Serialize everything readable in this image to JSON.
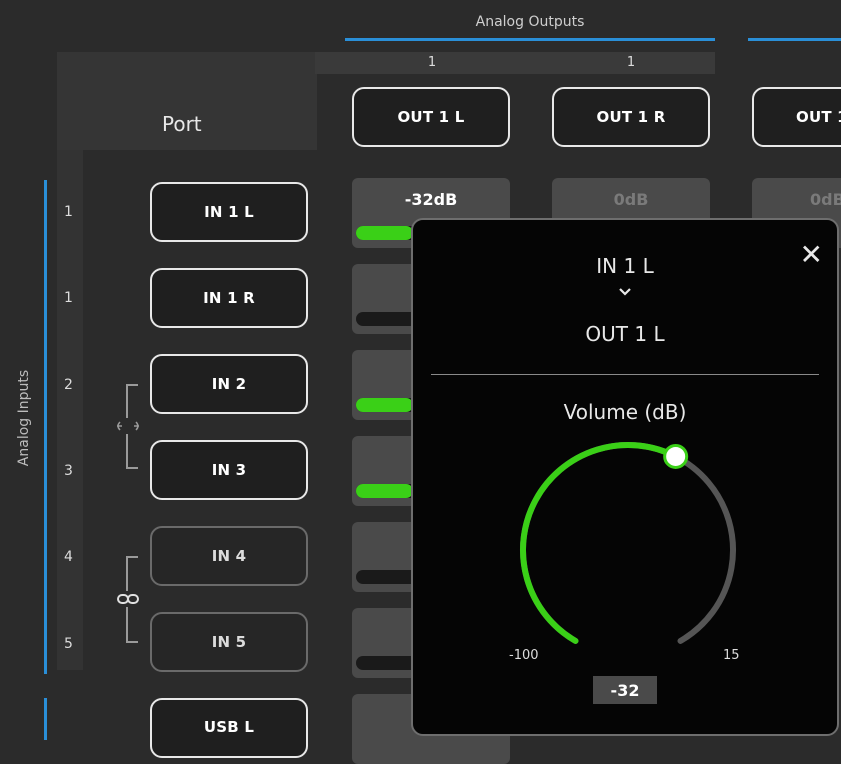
{
  "header": {
    "outputs_group_title": "Analog Outputs",
    "output_numbers": [
      "1",
      "1"
    ],
    "port_label": "Port"
  },
  "outputs": [
    {
      "label": "OUT 1 L"
    },
    {
      "label": "OUT 1 R"
    },
    {
      "label": "OUT 1"
    }
  ],
  "inputs_group_title": "Analog Inputs",
  "inputs": [
    {
      "num": "1",
      "label": "IN 1 L",
      "dim": false
    },
    {
      "num": "1",
      "label": "IN 1 R",
      "dim": false
    },
    {
      "num": "2",
      "label": "IN 2",
      "dim": false
    },
    {
      "num": "3",
      "label": "IN 3",
      "dim": false
    },
    {
      "num": "4",
      "label": "IN 4",
      "dim": true
    },
    {
      "num": "5",
      "label": "IN 5",
      "dim": true
    },
    {
      "num": "",
      "label": "USB L",
      "dim": false
    }
  ],
  "cells": {
    "r1c1_label": "-32dB",
    "r1c2_label": "0dB",
    "r1c3_label": "0dB"
  },
  "meters": [
    0.38,
    0.0,
    0.38,
    0.38,
    0.0,
    0.0
  ],
  "popup": {
    "source": "IN 1 L",
    "destination": "OUT 1 L",
    "volume_title": "Volume (dB)",
    "min": "-100",
    "max": "15",
    "value": "-32",
    "value_fraction": 0.59
  },
  "colors": {
    "accent_blue": "#2a8fd8",
    "meter_green": "#3ad017"
  },
  "icons": [
    "close-icon",
    "chevron-down-icon",
    "link-icon",
    "unlink-icon"
  ]
}
